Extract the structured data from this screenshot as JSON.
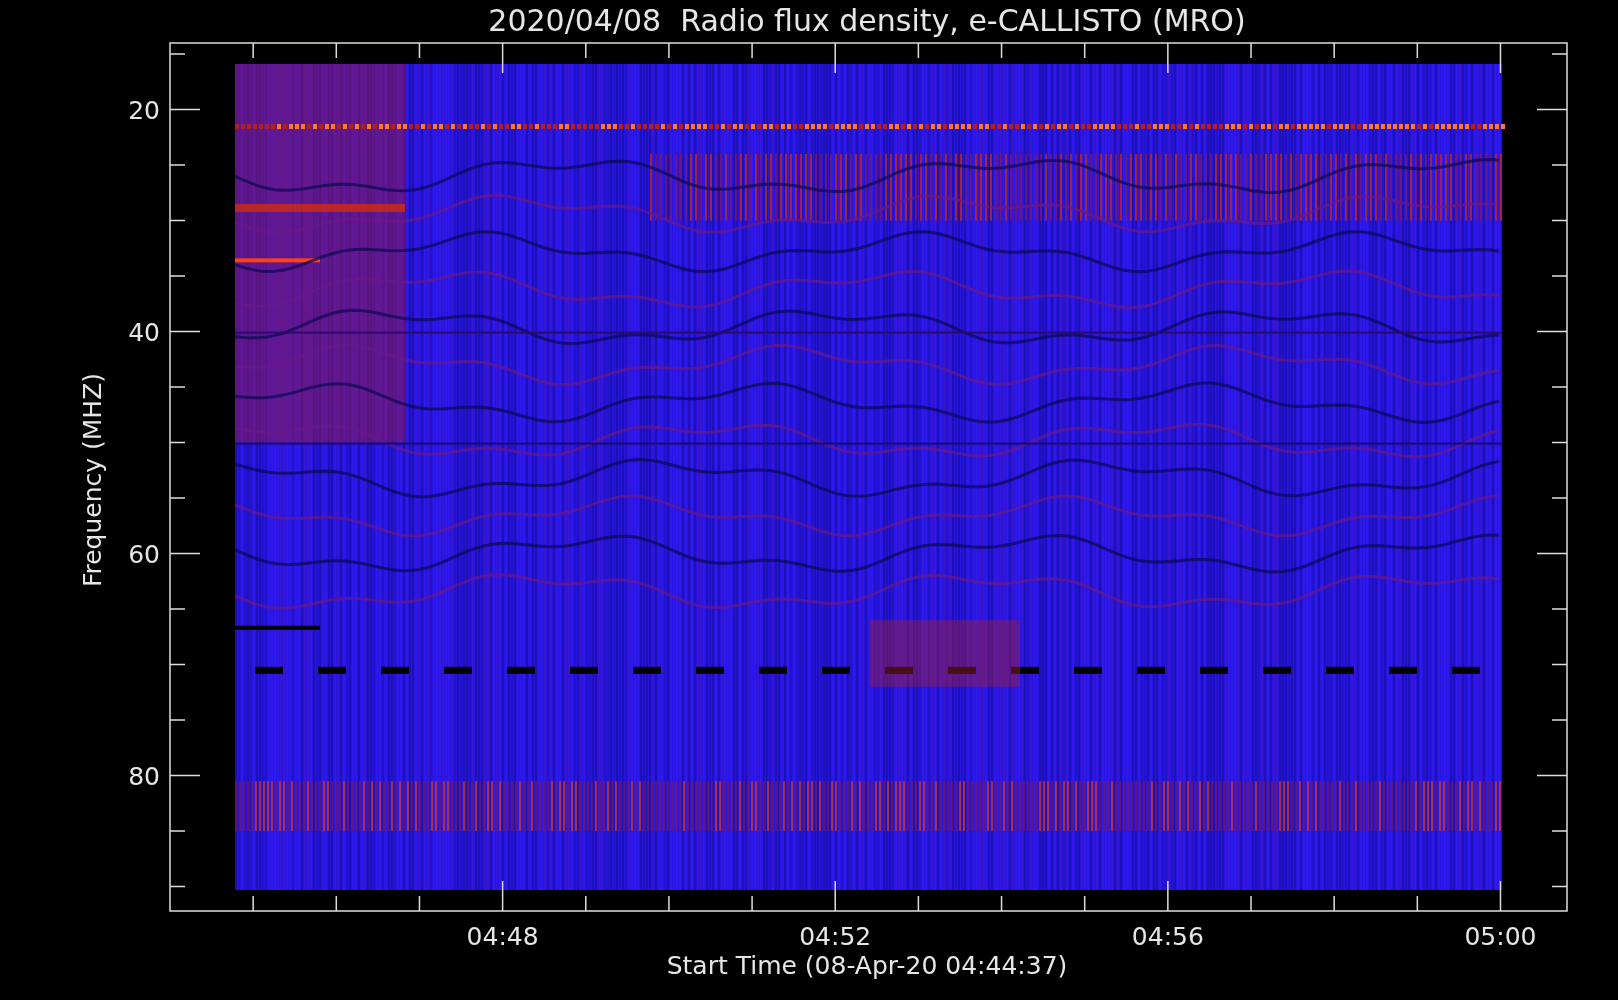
{
  "plot": {
    "title": "2020/04/08  Radio flux density, e-CALLISTO (MRO)",
    "ylabel": "Frequency (MHZ)",
    "xlabel": "Start Time (08-Apr-20 04:44:37)",
    "yticks": [
      "20",
      "40",
      "60",
      "80"
    ],
    "xticks": [
      "04:48",
      "04:52",
      "04:56",
      "05:00"
    ]
  }
}
